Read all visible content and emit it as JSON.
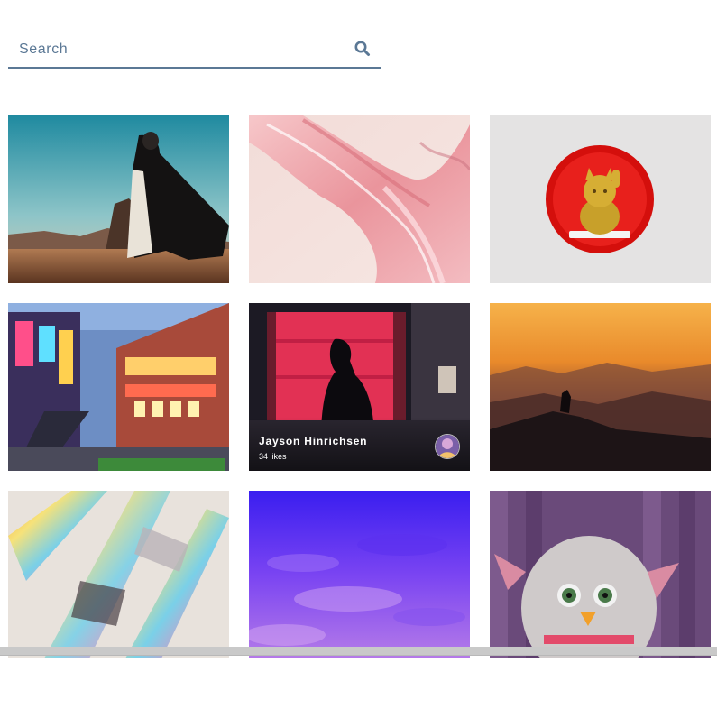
{
  "search": {
    "placeholder": "Search",
    "icon": "search-icon",
    "accent_color": "#5b7895"
  },
  "gallery": {
    "photos": [
      {
        "subject": "cloaked-figure-desert"
      },
      {
        "subject": "pink-glass-abstract"
      },
      {
        "subject": "golden-lucky-cat"
      },
      {
        "subject": "neon-street"
      },
      {
        "subject": "silhouette-red-window",
        "author": "Jayson Hinrichsen",
        "likes": "34 likes",
        "hovered": true
      },
      {
        "subject": "mountain-sunset-hiker"
      },
      {
        "subject": "iridescent-glass-tubes"
      },
      {
        "subject": "purple-liquid-surface"
      },
      {
        "subject": "furby-toy"
      }
    ]
  }
}
